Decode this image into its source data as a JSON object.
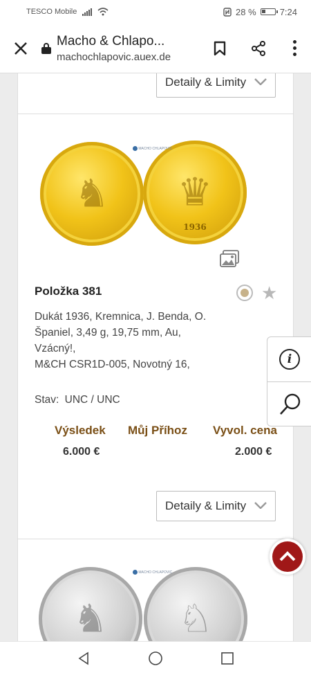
{
  "status": {
    "carrier": "TESCO Mobile",
    "battery": "28 %",
    "time": "7:24"
  },
  "browser": {
    "title": "Macho & Chlapo...",
    "url": "machochlapovic.auex.de"
  },
  "detail_button_label": "Detaily & Limity",
  "watermark": "MACHO CHLAPOVIC",
  "item": {
    "title": "Položka 381",
    "description_lines": [
      "Dukát 1936, Kremnica, J. Benda, O.",
      "Španiel, 3,49 g, 19,75 mm, Au,",
      "Vzácný!,",
      "M&CH CSR1D-005, Novotný 16,"
    ],
    "condition_label": "Stav:",
    "condition_value": "UNC / UNC",
    "coin_year": "1936",
    "result_label": "Výsledek",
    "my_bid_label": "Můj Příhoz",
    "start_price_label": "Vyvol. cena",
    "result_value": "6.000 €",
    "start_price_value": "2.000 €"
  },
  "icons": {
    "close": "close-icon",
    "lock": "lock-icon",
    "bookmark": "bookmark-icon",
    "share": "share-icon",
    "menu": "more-vert-icon",
    "gallery": "gallery-icon",
    "info": "info-icon",
    "search": "search-icon",
    "scroll_top": "chevron-up-icon"
  },
  "colors": {
    "accent_brown": "#7a4f16",
    "scroll_top_red": "#a01818"
  }
}
